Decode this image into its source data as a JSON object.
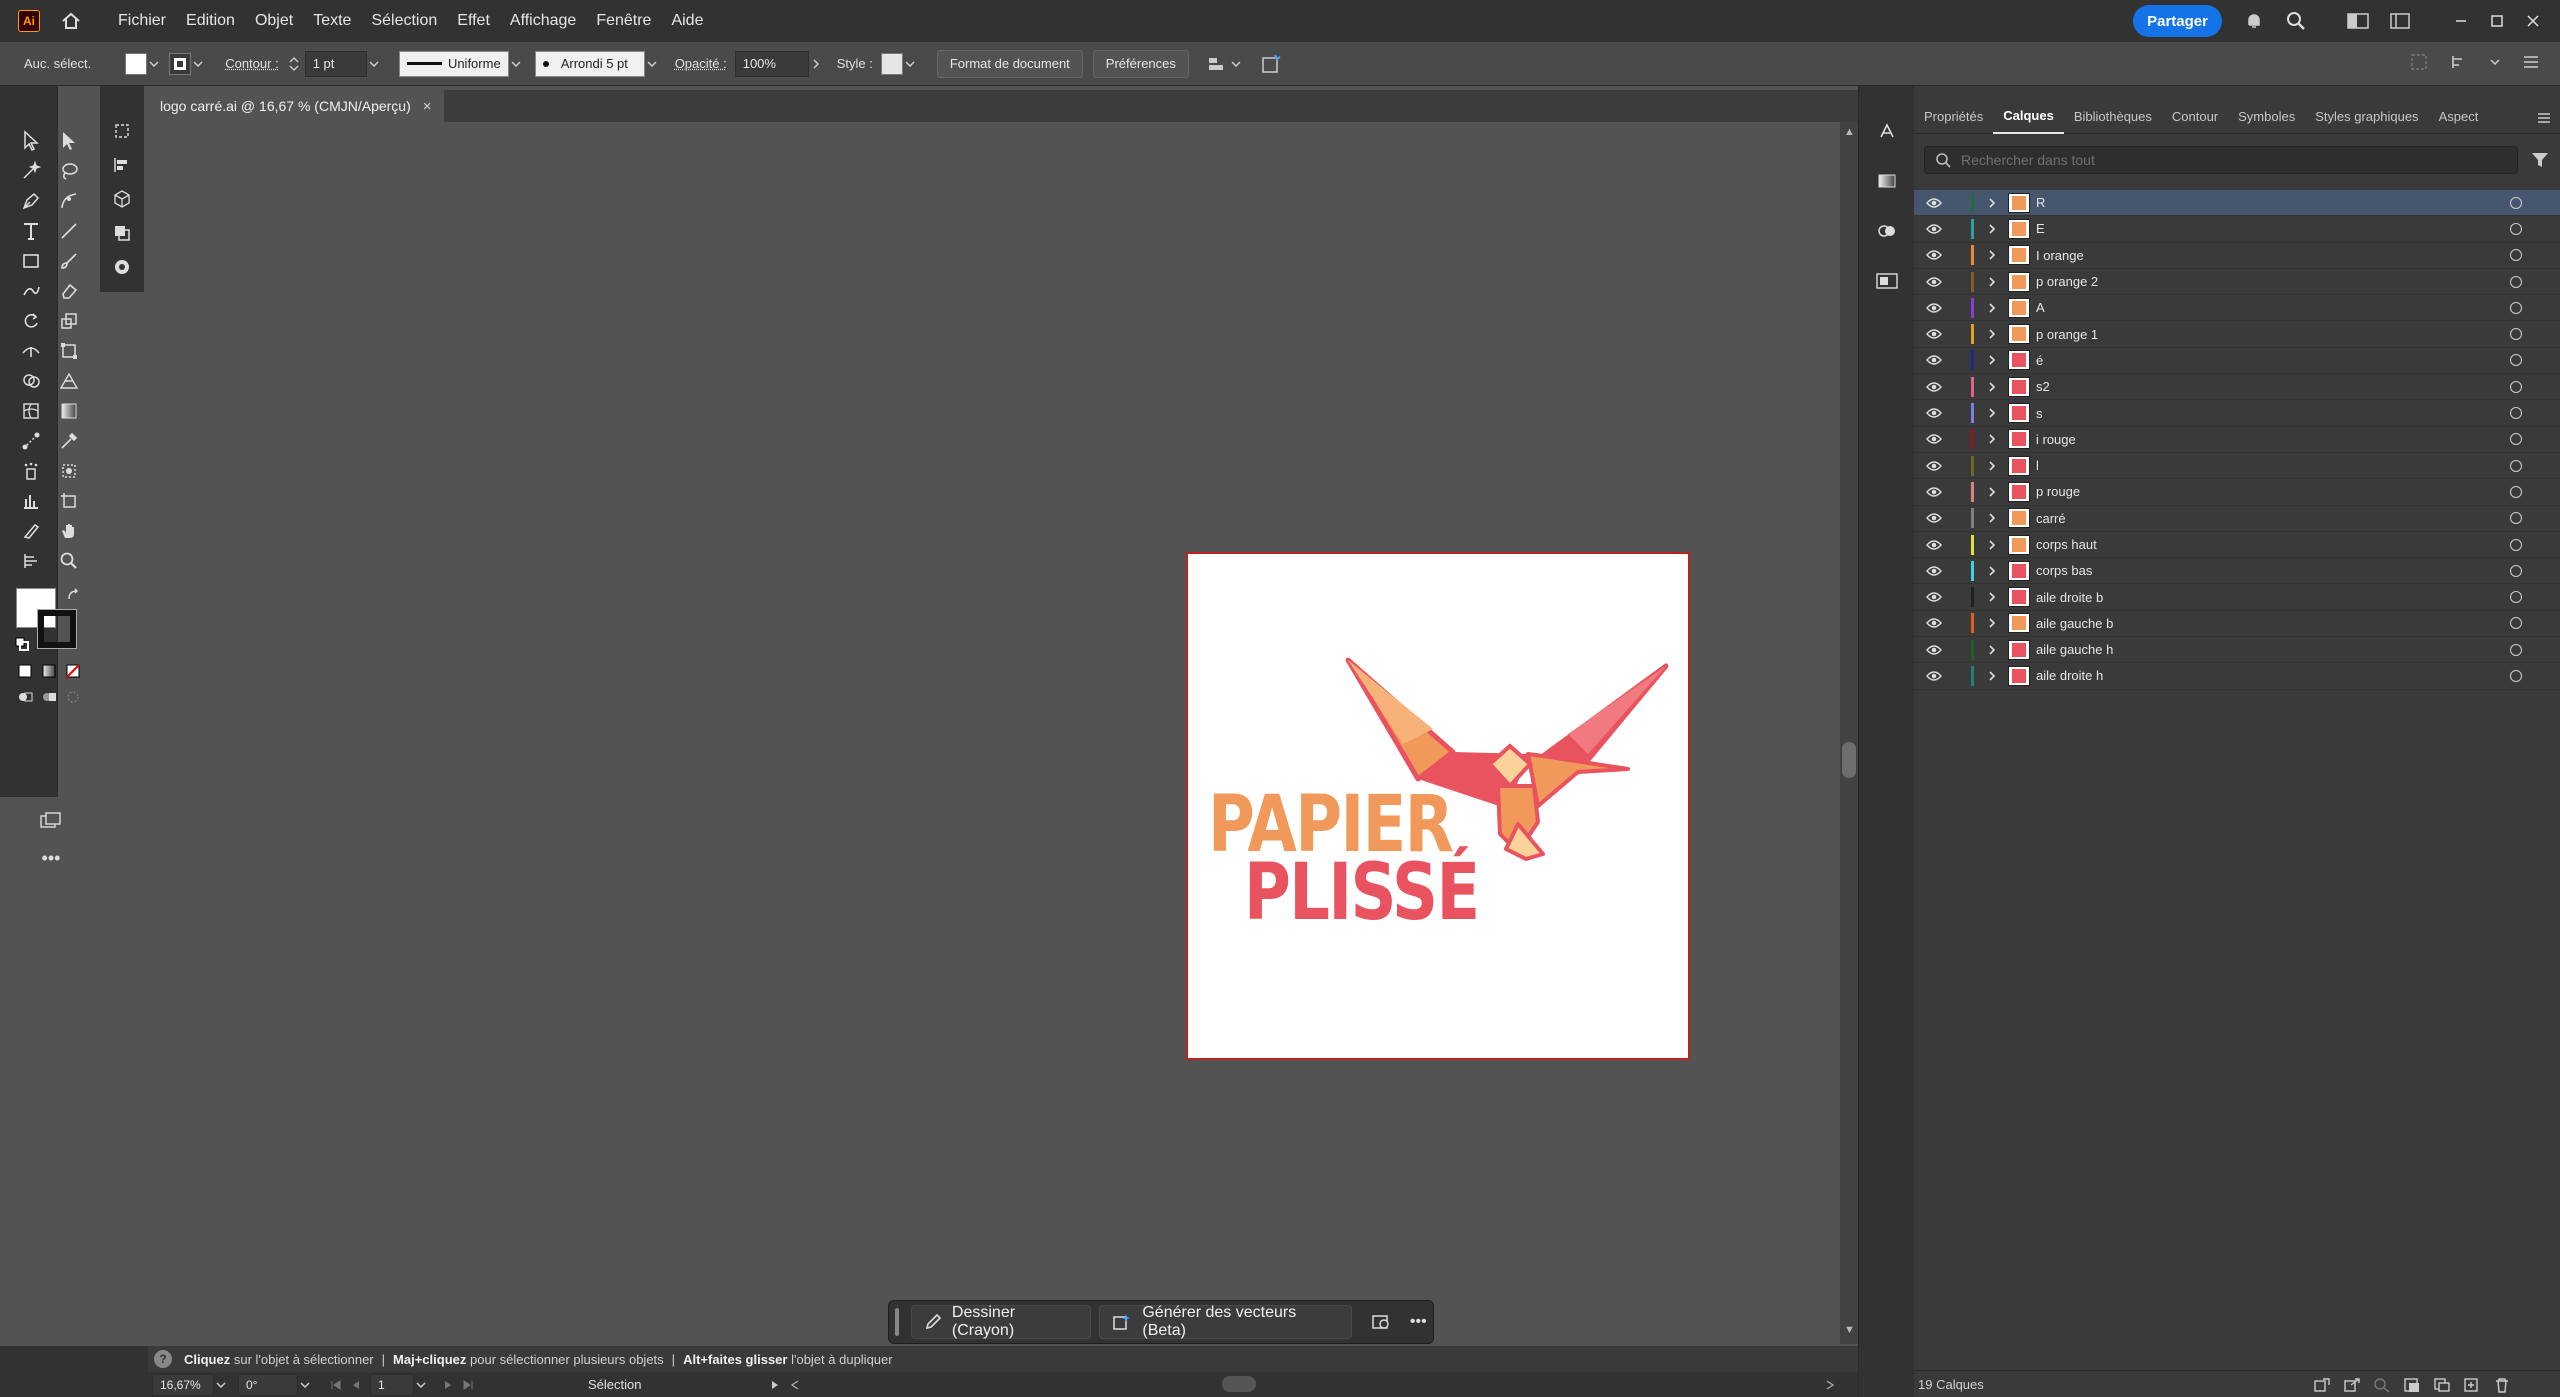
{
  "app": {
    "logo_text": "Ai"
  },
  "menu": [
    "Fichier",
    "Edition",
    "Objet",
    "Texte",
    "Sélection",
    "Effet",
    "Affichage",
    "Fenêtre",
    "Aide"
  ],
  "share_label": "Partager",
  "control": {
    "selection_state": "Auc. sélect.",
    "stroke_label": "Contour :",
    "stroke_weight": "1 pt",
    "stroke_profile": "Uniforme",
    "brush": "Arrondi 5 pt",
    "opacity_label": "Opacité :",
    "opacity_value": "100%",
    "style_label": "Style :",
    "doc_setup_button": "Format de document",
    "preferences_button": "Préférences"
  },
  "document": {
    "tab_title": "logo carré.ai @ 16,67 % (CMJN/Aperçu)",
    "close_glyph": "×"
  },
  "artwork": {
    "line1": "PAPIER",
    "line2": "PLISSÉ",
    "orange": "#f0995a",
    "red": "#e8535f"
  },
  "taskbar": {
    "draw_label": "Dessiner (Crayon)",
    "vectorize_label": "Générer des vecteurs (Beta)"
  },
  "hint": {
    "p1_bold": "Cliquez",
    "p1": "sur l'objet à sélectionner",
    "p2_bold": "Maj+cliquez",
    "p2": "pour sélectionner plusieurs objets",
    "p3_bold": "Alt+faites glisser",
    "p3": "l'objet à dupliquer",
    "separator": "|"
  },
  "status": {
    "zoom": "16,67%",
    "rotation": "0°",
    "artboard_number": "1",
    "tool": "Sélection"
  },
  "panel": {
    "tabs": [
      "Propriétés",
      "Calques",
      "Bibliothèques",
      "Contour",
      "Symboles",
      "Styles graphiques",
      "Aspect"
    ],
    "active_tab": "Calques",
    "search_placeholder": "Rechercher dans tout",
    "layer_count": "19 Calques"
  },
  "layers": [
    {
      "name": "R",
      "color": "#1f6e3a",
      "thumb": "#f0995a",
      "selected": true
    },
    {
      "name": "E",
      "color": "#2aa3a3",
      "thumb": "#f0995a"
    },
    {
      "name": "I orange",
      "color": "#e88a3b",
      "thumb": "#f0995a"
    },
    {
      "name": "p orange 2",
      "color": "#8b5a2b",
      "thumb": "#f0995a"
    },
    {
      "name": "A",
      "color": "#8a3fcf",
      "thumb": "#f0995a"
    },
    {
      "name": "p orange 1",
      "color": "#e0a020",
      "thumb": "#f0995a"
    },
    {
      "name": "é",
      "color": "#1a2a8a",
      "thumb": "#e8535f"
    },
    {
      "name": "s2",
      "color": "#e06090",
      "thumb": "#e8535f"
    },
    {
      "name": "s",
      "color": "#7a80e0",
      "thumb": "#e8535f"
    },
    {
      "name": "i rouge",
      "color": "#8a1a1a",
      "thumb": "#e8535f"
    },
    {
      "name": "l",
      "color": "#6a6a20",
      "thumb": "#e8535f"
    },
    {
      "name": "p rouge",
      "color": "#e08080",
      "thumb": "#e8535f"
    },
    {
      "name": "carré",
      "color": "#808080",
      "thumb": "#f0995a"
    },
    {
      "name": "corps haut",
      "color": "#e0e040",
      "thumb": "#f0995a"
    },
    {
      "name": "corps bas",
      "color": "#40d0e0",
      "thumb": "#e8535f"
    },
    {
      "name": "aile droite b",
      "color": "#202020",
      "thumb": "#e8535f"
    },
    {
      "name": "aile gauche b",
      "color": "#e06020",
      "thumb": "#f0995a"
    },
    {
      "name": "aile gauche h",
      "color": "#206020",
      "thumb": "#e8535f"
    },
    {
      "name": "aile droite h",
      "color": "#208080",
      "thumb": "#e8535f"
    }
  ]
}
